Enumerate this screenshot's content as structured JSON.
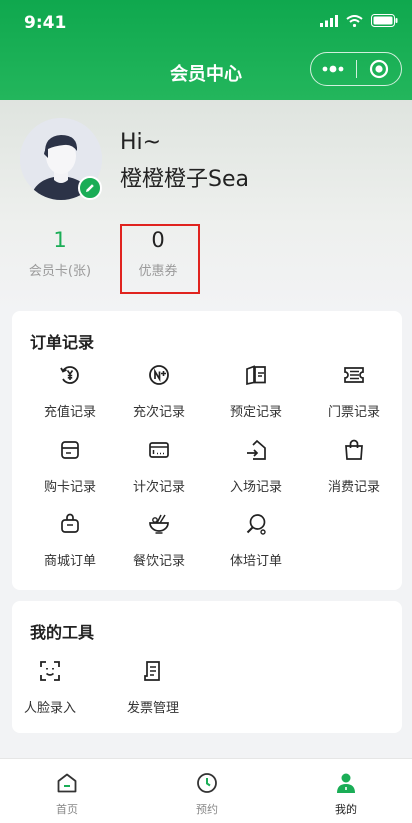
{
  "status_bar": {
    "time": "9:41"
  },
  "nav": {
    "title": "会员中心"
  },
  "profile": {
    "greeting": "Hi~",
    "username": "橙橙橙子Sea"
  },
  "stats": [
    {
      "value": "1",
      "label": "会员卡(张)",
      "color": "#1aad56"
    },
    {
      "value": "0",
      "label": "优惠券",
      "color": "#222222"
    }
  ],
  "orders": {
    "title": "订单记录",
    "items": [
      {
        "label": "充值记录",
        "icon": "yen-refresh-icon"
      },
      {
        "label": "充次记录",
        "icon": "n-plus-icon"
      },
      {
        "label": "预定记录",
        "icon": "booking-icon"
      },
      {
        "label": "门票记录",
        "icon": "ticket-icon"
      },
      {
        "label": "购卡记录",
        "icon": "card-icon"
      },
      {
        "label": "计次记录",
        "icon": "count-card-icon"
      },
      {
        "label": "入场记录",
        "icon": "entry-icon"
      },
      {
        "label": "消费记录",
        "icon": "shopping-bag-icon"
      },
      {
        "label": "商城订单",
        "icon": "mall-bag-icon"
      },
      {
        "label": "餐饮记录",
        "icon": "food-bowl-icon"
      },
      {
        "label": "体培订单",
        "icon": "racket-icon"
      }
    ]
  },
  "tools": {
    "title": "我的工具",
    "items": [
      {
        "label": "人脸录入",
        "icon": "face-scan-icon"
      },
      {
        "label": "发票管理",
        "icon": "invoice-icon"
      }
    ]
  },
  "tabbar": {
    "items": [
      {
        "label": "首页",
        "icon": "home-icon",
        "active": false
      },
      {
        "label": "预约",
        "icon": "clock-icon",
        "active": false
      },
      {
        "label": "我的",
        "icon": "user-icon",
        "active": true
      }
    ]
  },
  "colors": {
    "brand": "#1aad56",
    "highlight": "#e0231f"
  }
}
